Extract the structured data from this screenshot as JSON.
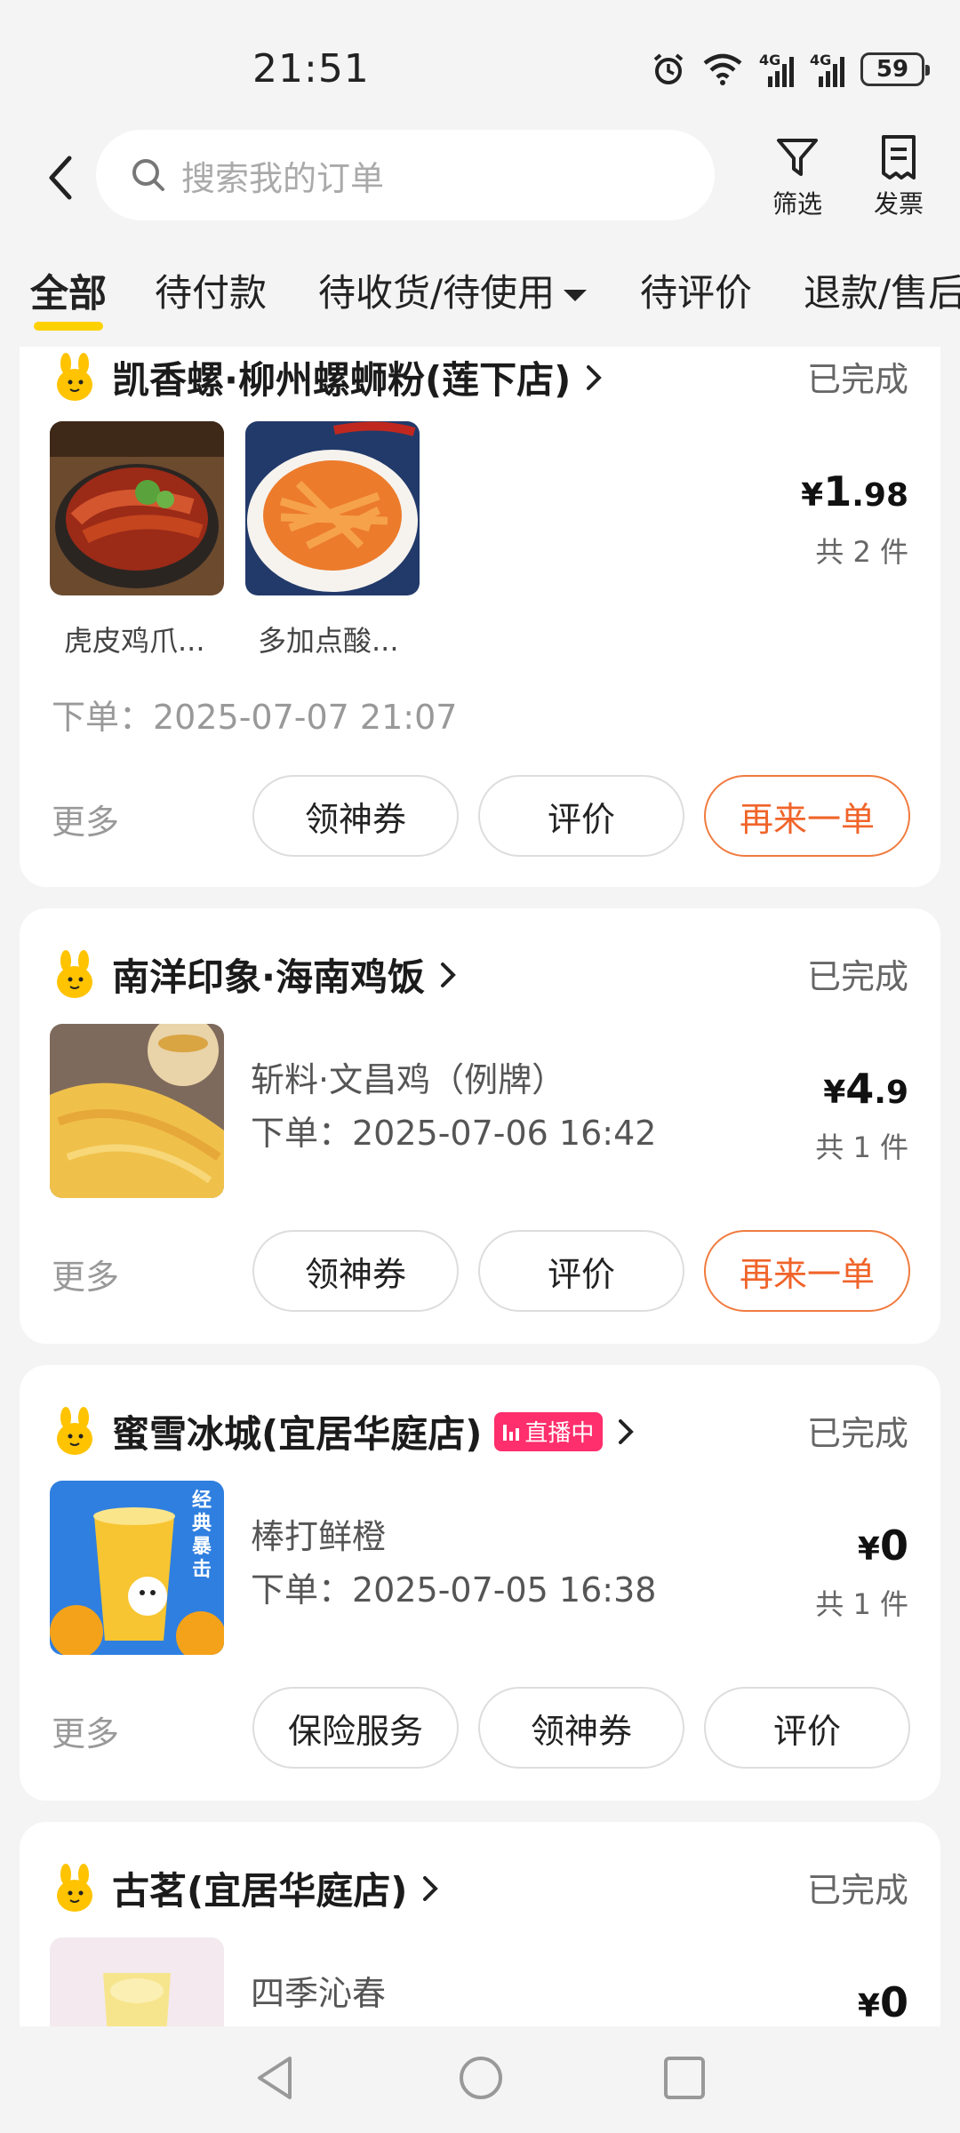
{
  "status_bar": {
    "time": "21:51",
    "network_1": "4G",
    "network_2": "4G",
    "battery": "59"
  },
  "header": {
    "search_placeholder": "搜索我的订单",
    "filter_label": "筛选",
    "invoice_label": "发票"
  },
  "tabs": [
    {
      "label": "全部",
      "active": true
    },
    {
      "label": "待付款"
    },
    {
      "label": "待收货/待使用"
    },
    {
      "label": "待评价"
    },
    {
      "label": "退款/售后"
    }
  ],
  "orders": [
    {
      "shop": "凯香螺·柳州螺蛳粉(莲下店)",
      "status": "已完成",
      "items": [
        "虎皮鸡爪...",
        "多加点酸..."
      ],
      "order_time": "下单：2025-07-07 21:07",
      "price_symbol": "¥",
      "price_int": "1",
      "price_dec": ".98",
      "count": "共 2 件",
      "more": "更多",
      "buttons": [
        "领神券",
        "评价",
        "再来一单"
      ]
    },
    {
      "shop": "南洋印象·海南鸡饭",
      "status": "已完成",
      "item_name": "斩料·文昌鸡（例牌）",
      "order_time": "下单：2025-07-06 16:42",
      "price_symbol": "¥",
      "price_int": "4",
      "price_dec": ".9",
      "count": "共 1 件",
      "more": "更多",
      "buttons": [
        "领神券",
        "评价",
        "再来一单"
      ]
    },
    {
      "shop": "蜜雪冰城(宜居华庭店)",
      "live_badge": "直播中",
      "status": "已完成",
      "item_name": "棒打鲜橙",
      "order_time": "下单：2025-07-05 16:38",
      "price_symbol": "¥",
      "price_int": "0",
      "count": "共 1 件",
      "more": "更多",
      "buttons": [
        "保险服务",
        "领神券",
        "评价"
      ],
      "thumb_text": "经典暴击"
    },
    {
      "shop": "古茗(宜居华庭店)",
      "status": "已完成",
      "item_name": "四季沁春",
      "price_symbol": "¥",
      "price_int": "0"
    }
  ],
  "colors": {
    "accent_orange": "#f0642a",
    "tab_underline": "#ffd100",
    "live_badge": "#ff2e6c"
  }
}
